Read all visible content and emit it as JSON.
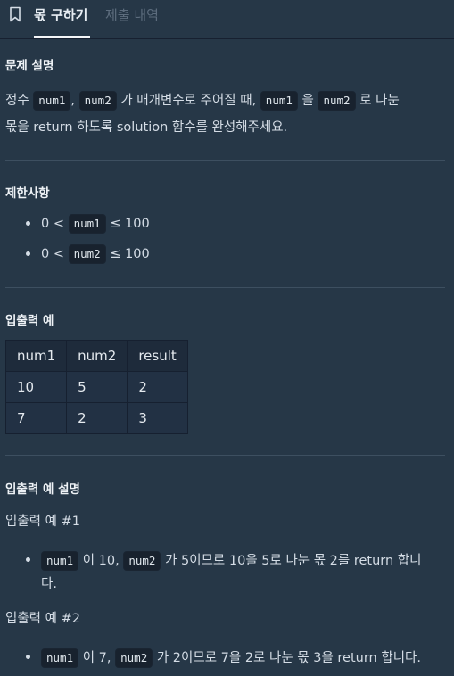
{
  "tabs": {
    "active": "몫 구하기",
    "inactive": "제출 내역"
  },
  "problem": {
    "heading": "문제 설명",
    "line1": {
      "t1": "정수",
      "c1": "num1",
      "t2": ",",
      "c2": "num2",
      "t3": "가 매개변수로 주어질 때,",
      "c3": "num1",
      "t4": "을",
      "c4": "num2",
      "t5": "로 나눈"
    },
    "line2": "몫을 return 하도록 solution 함수를 완성해주세요."
  },
  "constraints": {
    "heading": "제한사항",
    "items": [
      {
        "pre": "0 <",
        "code": "num1",
        "post": "≤ 100"
      },
      {
        "pre": "0 <",
        "code": "num2",
        "post": "≤ 100"
      }
    ]
  },
  "io": {
    "heading": "입출력 예",
    "headers": [
      "num1",
      "num2",
      "result"
    ],
    "rows": [
      [
        "10",
        "5",
        "2"
      ],
      [
        "7",
        "2",
        "3"
      ]
    ]
  },
  "io_explain": {
    "heading": "입출력 예 설명",
    "ex1": {
      "title": "입출력 예 #1",
      "c1": "num1",
      "t1": "이 10,",
      "c2": "num2",
      "t2": "가 5이므로 10을 5로 나눈 몫 2를 return 합니",
      "t3": "다."
    },
    "ex2": {
      "title": "입출력 예 #2",
      "c1": "num1",
      "t1": "이 7,",
      "c2": "num2",
      "t2": "가 2이므로 7을 2로 나눈 몫 3을 return 합니다."
    }
  }
}
